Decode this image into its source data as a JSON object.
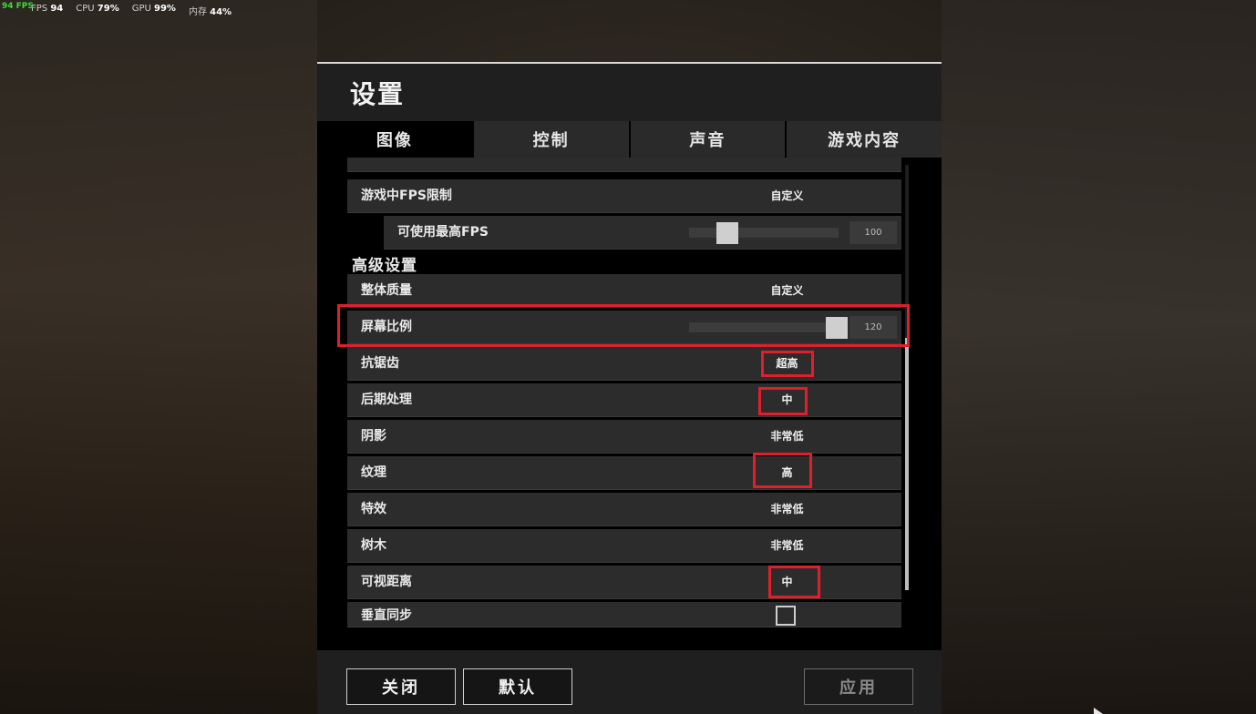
{
  "hud": {
    "fps_tag": "94 FPS",
    "fps_label": "FPS",
    "fps_value": "94",
    "cpu_label": "CPU",
    "cpu_value": "79%",
    "gpu_label": "GPU",
    "gpu_value": "99%",
    "mem_label": "内存",
    "mem_value": "44%"
  },
  "dialog": {
    "title": "设置",
    "tabs": [
      {
        "label": "图像",
        "active": true
      },
      {
        "label": "控制",
        "active": false
      },
      {
        "label": "声音",
        "active": false
      },
      {
        "label": "游戏内容",
        "active": false
      }
    ],
    "rows": {
      "fps_limit": {
        "label": "游戏中FPS限制",
        "value": "自定义"
      },
      "max_fps": {
        "label": "可使用最高FPS",
        "value": "100",
        "slider_fraction": 0.26
      },
      "advanced_section": "高级设置",
      "overall_quality": {
        "label": "整体质量",
        "value": "自定义"
      },
      "screen_scale": {
        "label": "屏幕比例",
        "value": "120",
        "slider_fraction": 1.0
      },
      "anti_aliasing": {
        "label": "抗锯齿",
        "value": "超高"
      },
      "post_processing": {
        "label": "后期处理",
        "value": "中"
      },
      "shadows": {
        "label": "阴影",
        "value": "非常低"
      },
      "textures": {
        "label": "纹理",
        "value": "高"
      },
      "effects": {
        "label": "特效",
        "value": "非常低"
      },
      "foliage": {
        "label": "树木",
        "value": "非常低"
      },
      "view_distance": {
        "label": "可视距离",
        "value": "中"
      },
      "vsync": {
        "label": "垂直同步",
        "checked": false
      }
    },
    "footer": {
      "close_label": "关闭",
      "default_label": "默认",
      "apply_label": "应用"
    }
  },
  "colors": {
    "highlight": "#e01f2b",
    "fps_green": "#3cdc3c"
  }
}
